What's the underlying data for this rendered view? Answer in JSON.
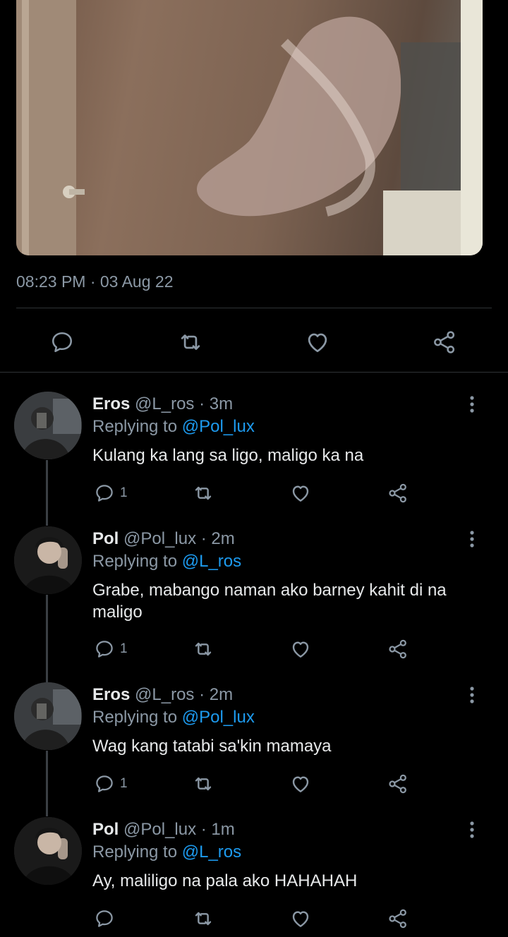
{
  "tweet": {
    "timestamp": "08:23 PM · 03 Aug 22",
    "actions": [
      "reply",
      "retweet",
      "like",
      "share"
    ]
  },
  "replies": [
    {
      "name": "Eros",
      "meta": "@L_ros · 3m",
      "replying_prefix": "Replying to",
      "replying_to": "@Pol_lux",
      "text": "Kulang ka lang sa ligo, maligo ka na",
      "reply_count": "1"
    },
    {
      "name": "Pol",
      "meta": "@Pol_lux · 2m",
      "replying_prefix": "Replying to",
      "replying_to": "@L_ros",
      "text": "Grabe, mabango naman ako barney kahit di na maligo",
      "reply_count": "1"
    },
    {
      "name": "Eros",
      "meta": "@L_ros · 2m",
      "replying_prefix": "Replying to",
      "replying_to": "@Pol_lux",
      "text": "Wag kang tatabi sa'kin mamaya",
      "reply_count": "1"
    },
    {
      "name": "Pol",
      "meta": "@Pol_lux · 1m",
      "replying_prefix": "Replying to",
      "replying_to": "@L_ros",
      "text": "Ay, maliligo na pala ako HAHAHAH",
      "reply_count": ""
    }
  ],
  "colors": {
    "background": "#000000",
    "text": "#e7e9ea",
    "muted": "#8b98a5",
    "mention": "#1d9bf0"
  }
}
